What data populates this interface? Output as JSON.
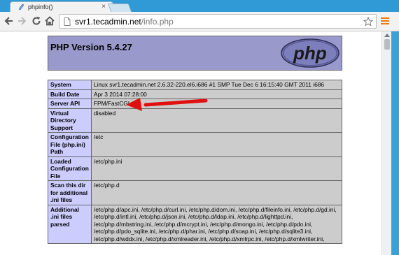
{
  "browser": {
    "tab_title": "phpinfo()",
    "tab_close": "×",
    "url_host": "svr1.tecadmin.net",
    "url_path": "/info.php"
  },
  "page": {
    "title": "PHP Version 5.4.27",
    "logo_text": "php"
  },
  "rows": [
    {
      "label": "System",
      "value": "Linux svr1.tecadmin.net 2.6.32-220.el6.i686 #1 SMP Tue Dec 6 16:15:40 GMT 2011 i686"
    },
    {
      "label": "Build Date",
      "value": "Apr 3 2014 07:28:00"
    },
    {
      "label": "Server API",
      "value": "FPM/FastCGI"
    },
    {
      "label": "Virtual Directory Support",
      "value": "disabled"
    },
    {
      "label": "Configuration File (php.ini) Path",
      "value": "/etc"
    },
    {
      "label": "Loaded Configuration File",
      "value": "/etc/php.ini"
    },
    {
      "label": "Scan this dir for additional .ini files",
      "value": "/etc/php.d"
    },
    {
      "label": "Additional .ini files parsed",
      "value": "/etc/php.d/apc.ini, /etc/php.d/curl.ini, /etc/php.d/dom.ini, /etc/php.d/fileinfo.ini, /etc/php.d/gd.ini, /etc/php.d/intl.ini, /etc/php.d/json.ini, /etc/php.d/ldap.ini, /etc/php.d/lighttpd.ini, /etc/php.d/mbstring.ini, /etc/php.d/mcrypt.ini, /etc/php.d/mongo.ini, /etc/php.d/pdo.ini, /etc/php.d/pdo_sqlite.ini, /etc/php.d/phar.ini, /etc/php.d/soap.ini, /etc/php.d/sqlite3.ini, /etc/php.d/wddx.ini, /etc/php.d/xmlreader.ini, /etc/php.d/xmlrpc.ini, /etc/php.d/xmlwriter.ini,"
    }
  ],
  "colors": {
    "header_bg": "#9999cc",
    "label_bg": "#ccccff",
    "value_bg": "#cccccc",
    "annotation_arrow": "#e01010",
    "menu_accent": "#e8790f"
  }
}
